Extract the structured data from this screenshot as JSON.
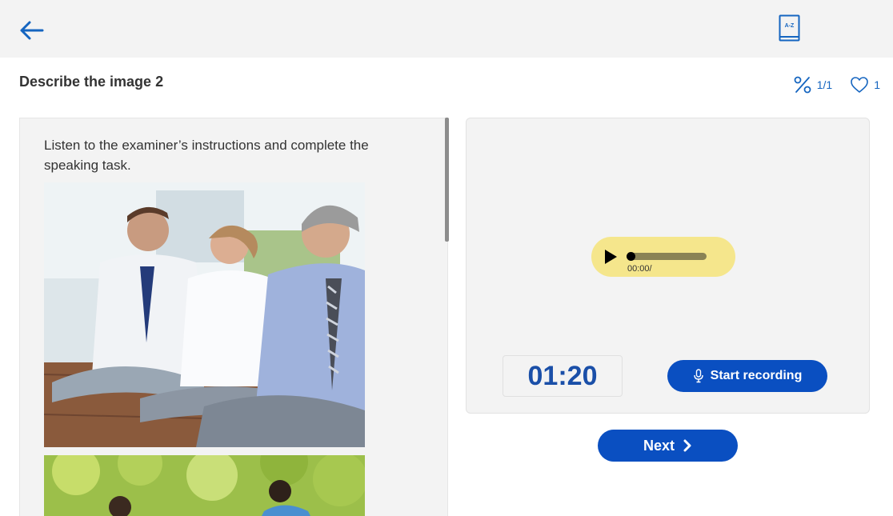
{
  "header": {
    "back_icon": "arrow-left-icon",
    "dictionary_icon": "dictionary-az-icon",
    "dictionary_label": "A-Z"
  },
  "task": {
    "title": "Describe the image 2",
    "progress": "1/1",
    "likes": "1",
    "instructions": "Listen to the examiner’s instructions and complete the speaking task.",
    "images": [
      {
        "description": "people-meditating-photo"
      },
      {
        "description": "outdoor-park-photo"
      }
    ]
  },
  "audio": {
    "time": "00:00/",
    "progress": 0
  },
  "recorder": {
    "timer": "01:20",
    "start_label": "Start recording"
  },
  "nav": {
    "next_label": "Next"
  },
  "colors": {
    "accent": "#0a4fc1",
    "audio_bg": "#f5e68c",
    "panel_bg": "#f3f3f3"
  }
}
